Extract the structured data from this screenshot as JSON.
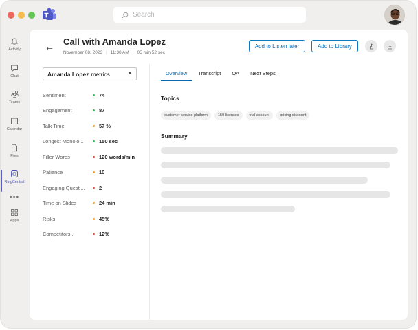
{
  "window": {
    "colors": {
      "accent": "#5b5fc7",
      "link_blue": "#0a6cb0"
    }
  },
  "search": {
    "placeholder": "Search",
    "icon": "search-icon"
  },
  "rail": {
    "items": [
      {
        "label": "Activity",
        "icon": "bell-icon"
      },
      {
        "label": "Chat",
        "icon": "chat-icon"
      },
      {
        "label": "Teams",
        "icon": "teams-icon"
      },
      {
        "label": "Calendar",
        "icon": "calendar-icon"
      },
      {
        "label": "Files",
        "icon": "file-icon"
      },
      {
        "label": "RingCentral",
        "icon": "ringcentral-icon",
        "active": true
      },
      {
        "label": "Apps",
        "icon": "apps-icon"
      }
    ],
    "more": "•••"
  },
  "header": {
    "title": "Call with Amanda Lopez",
    "date": "November 08, 2023",
    "time": "11:30 AM",
    "duration": "05 min 52 sec",
    "listen_later_label": "Add to Listen later",
    "library_label": "Add to Library"
  },
  "metrics": {
    "select_name": "Amanda Lopez",
    "select_suffix": "metrics",
    "rows": [
      {
        "label": "Sentiment",
        "value": "74",
        "status": "#3fb950"
      },
      {
        "label": "Engagement",
        "value": "87",
        "status": "#3fb950"
      },
      {
        "label": "Talk Time",
        "value": "57 %",
        "status": "#f0a030"
      },
      {
        "label": "Longest Monolo...",
        "value": "150 sec",
        "status": "#3fb950"
      },
      {
        "label": "Filler Words",
        "value": "120 words/min",
        "status": "#d9443a"
      },
      {
        "label": "Patience",
        "value": "10",
        "status": "#f0a030"
      },
      {
        "label": "Engaging Questi...",
        "value": "2",
        "status": "#d9443a"
      },
      {
        "label": "Time on Slides",
        "value": "24 min",
        "status": "#f0a030"
      },
      {
        "label": "Risks",
        "value": "45%",
        "status": "#f0a030"
      },
      {
        "label": "Competitors...",
        "value": "12%",
        "status": "#d9443a"
      }
    ]
  },
  "tabs": [
    {
      "label": "Overview",
      "active": true
    },
    {
      "label": "Transcript"
    },
    {
      "label": "QA"
    },
    {
      "label": "Next Steps"
    }
  ],
  "topics": {
    "heading": "Topics",
    "chips": [
      "customer service platform",
      "150 licenses",
      "trial account",
      "pricing discount"
    ]
  },
  "summary": {
    "heading": "Summary"
  }
}
